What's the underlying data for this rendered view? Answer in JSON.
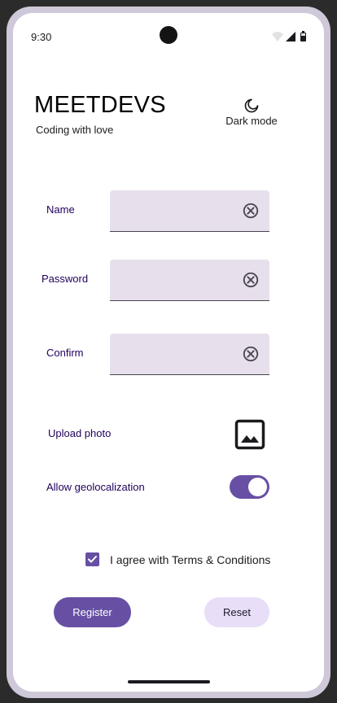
{
  "status_bar": {
    "time": "9:30"
  },
  "header": {
    "title": "MEETDEVS",
    "subtitle": "Coding with love",
    "dark_mode_label": "Dark mode"
  },
  "form": {
    "name_label": "Name",
    "password_label": "Password",
    "confirm_label": "Confirm",
    "name_value": "",
    "password_value": "",
    "confirm_value": "",
    "upload_label": "Upload photo",
    "geo_label": "Allow geolocalization",
    "geo_enabled": true,
    "terms_label": "I agree with Terms & Conditions",
    "terms_checked": true
  },
  "actions": {
    "register_label": "Register",
    "reset_label": "Reset"
  },
  "colors": {
    "primary": "#6750a4",
    "label": "#21005d",
    "field_bg": "#e7e0ec",
    "secondary_container": "#e8def8"
  }
}
